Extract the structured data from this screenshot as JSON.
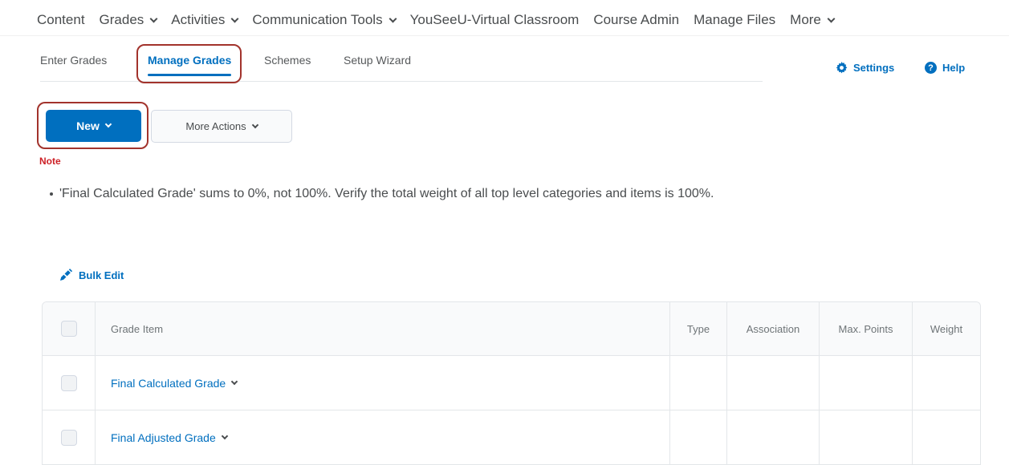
{
  "top_nav": {
    "items": [
      {
        "label": "Content",
        "dropdown": false
      },
      {
        "label": "Grades",
        "dropdown": true
      },
      {
        "label": "Activities",
        "dropdown": true
      },
      {
        "label": "Communication Tools",
        "dropdown": true
      },
      {
        "label": "YouSeeU-Virtual Classroom",
        "dropdown": false
      },
      {
        "label": "Course Admin",
        "dropdown": false
      },
      {
        "label": "Manage Files",
        "dropdown": false
      },
      {
        "label": "More",
        "dropdown": true
      }
    ]
  },
  "sub_tabs": {
    "items": [
      {
        "label": "Enter Grades",
        "active": false
      },
      {
        "label": "Manage Grades",
        "active": true
      },
      {
        "label": "Schemes",
        "active": false
      },
      {
        "label": "Setup Wizard",
        "active": false
      }
    ]
  },
  "top_actions": {
    "settings_label": "Settings",
    "help_label": "Help"
  },
  "toolbar": {
    "new_label": "New",
    "more_actions_label": "More Actions"
  },
  "note": {
    "label": "Note",
    "text": "'Final Calculated Grade' sums to 0%, not 100%. Verify the total weight of all top level categories and items is 100%."
  },
  "bulk_edit_label": "Bulk Edit",
  "table": {
    "headers": {
      "item": "Grade Item",
      "type": "Type",
      "association": "Association",
      "max_points": "Max. Points",
      "weight": "Weight"
    },
    "rows": [
      {
        "name": "Final Calculated Grade",
        "type": "",
        "association": "",
        "max_points": "",
        "weight": ""
      },
      {
        "name": "Final Adjusted Grade",
        "type": "",
        "association": "",
        "max_points": "",
        "weight": ""
      }
    ]
  },
  "colors": {
    "accent": "#006fbf",
    "note_red": "#cd2026",
    "highlight_ring": "#a2332c"
  }
}
